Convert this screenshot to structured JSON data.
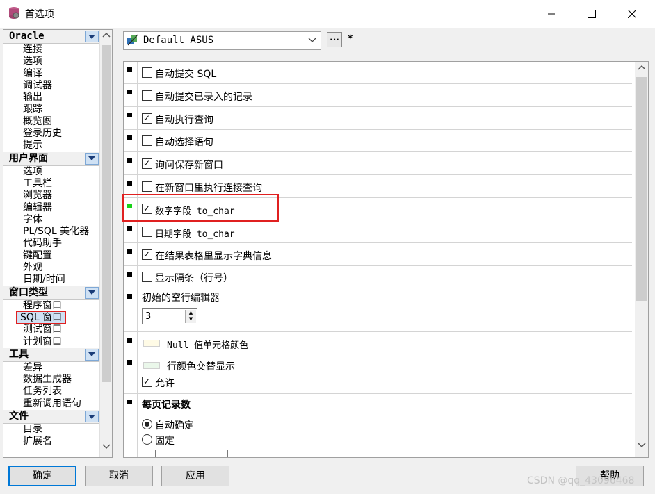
{
  "window": {
    "title": "首选项",
    "min_icon": "minimize-icon",
    "max_icon": "maximize-icon",
    "close_icon": "close-icon"
  },
  "left_nav": {
    "groups": [
      {
        "title": "Oracle",
        "items": [
          "连接",
          "选项",
          "编译",
          "调试器",
          "输出",
          "跟踪",
          "概览图",
          "登录历史",
          "提示"
        ]
      },
      {
        "title": "用户界面",
        "items": [
          "选项",
          "工具栏",
          "浏览器",
          "编辑器",
          "字体",
          "PL/SQL 美化器",
          "代码助手",
          "键配置",
          "外观",
          "日期/时间"
        ]
      },
      {
        "title": "窗口类型",
        "items": [
          "程序窗口",
          "SQL 窗口",
          "测试窗口",
          "计划窗口"
        ],
        "selected": "SQL 窗口"
      },
      {
        "title": "工具",
        "items": [
          "差异",
          "数据生成器",
          "任务列表",
          "重新调用语句"
        ]
      },
      {
        "title": "文件",
        "items": [
          "目录",
          "扩展名"
        ]
      }
    ]
  },
  "profile": {
    "value": "Default ASUS",
    "more_label": "...",
    "modified_mark": "*"
  },
  "options": {
    "auto_commit": {
      "label": "自动提交 SQL",
      "checked": false
    },
    "auto_commit_imported": {
      "label": "自动提交已录入的记录",
      "checked": false
    },
    "auto_execute": {
      "label": "自动执行查询",
      "checked": true
    },
    "auto_select": {
      "label": "自动选择语句",
      "checked": false
    },
    "ask_save_new": {
      "label": "询问保存新窗口",
      "checked": true
    },
    "exec_in_new": {
      "label": "在新窗口里执行连接查询",
      "checked": false
    },
    "number_to_char": {
      "label": "数字字段 to_char",
      "checked": true
    },
    "date_to_char": {
      "label": "日期字段 to_char",
      "checked": false
    },
    "show_dict": {
      "label": "在结果表格里显示字典信息",
      "checked": true
    },
    "show_stripes": {
      "label": "显示隔条（行号）",
      "checked": false
    },
    "initial_empty_rows": {
      "label": "初始的空行编辑器",
      "value": "3"
    },
    "null_color": {
      "label": "Null 值单元格颜色",
      "color": "#fffbe6"
    },
    "alt_row_color": {
      "label": "行颜色交替显示",
      "color": "#eaf7ea",
      "allow_label": "允许",
      "allow_checked": true
    },
    "records_per_page": {
      "label": "每页记录数",
      "auto_label": "自动确定",
      "fixed_label": "固定",
      "selected": "auto"
    }
  },
  "buttons": {
    "ok": "确定",
    "cancel": "取消",
    "apply": "应用",
    "help": "帮助"
  },
  "watermark": "CSDN @qq_43096468"
}
